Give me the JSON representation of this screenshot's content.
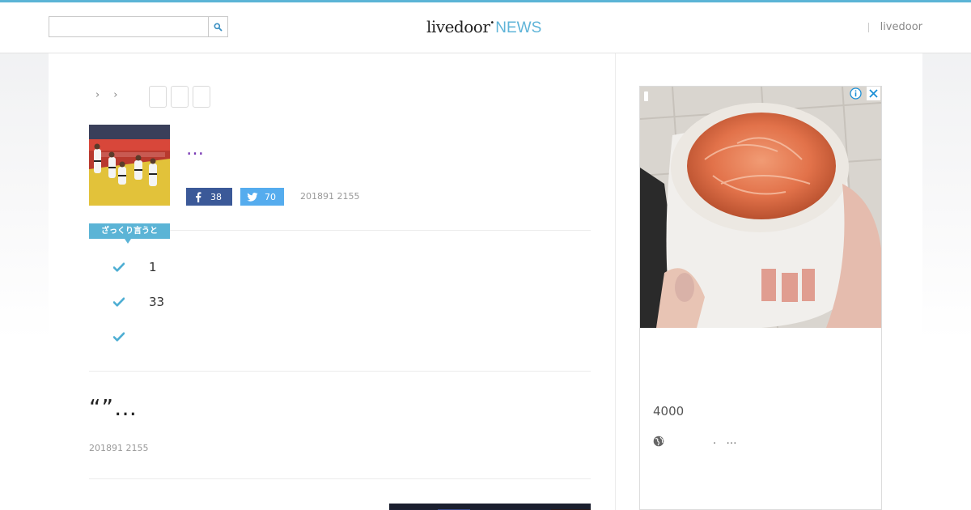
{
  "header": {
    "search_placeholder": "",
    "logo_main": "livedoor",
    "logo_news": "NEWS",
    "right_link": "livedoor"
  },
  "breadcrumb": {
    "separators": [
      "›",
      "›"
    ],
    "tag_count": 3
  },
  "article": {
    "title": "…",
    "facebook_count": "38",
    "twitter_count": "70",
    "date": "201891 2155"
  },
  "summary": {
    "badge": "ざっくり言うと",
    "points": [
      "1",
      "33",
      ""
    ]
  },
  "related": {
    "title": "“”…",
    "date": "201891 2155"
  },
  "ad": {
    "price": "4000",
    "url": ".   …"
  },
  "colors": {
    "accent": "#5bb4d6",
    "facebook": "#3b5998",
    "twitter": "#55acee",
    "title": "#7a3ab5"
  }
}
